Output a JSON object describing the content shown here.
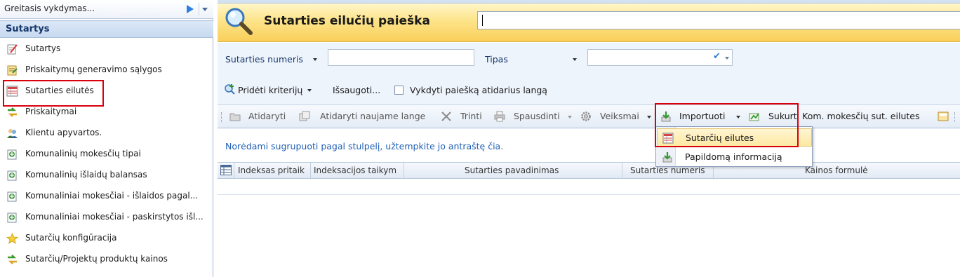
{
  "quick_launch": {
    "text": "Greitasis vykdymas..."
  },
  "nav": {
    "header": "Sutartys",
    "items": [
      {
        "label": "Sutartys",
        "icon": "edit-document-icon"
      },
      {
        "label": "Priskaitymų generavimo sąlygos",
        "icon": "conditions-icon"
      },
      {
        "label": "Sutarties eilutės",
        "icon": "table-rows-icon"
      },
      {
        "label": "Priskaitymai",
        "icon": "arrow-transfer-icon"
      },
      {
        "label": "Klientu apyvartos.",
        "icon": "people-icon"
      },
      {
        "label": "Komunalinių mokesčių tipai",
        "icon": "utility-icon"
      },
      {
        "label": "Komunalinių išlaidų balansas",
        "icon": "utility-icon"
      },
      {
        "label": "Komunaliniai mokesčiai - išlaidos pagal...",
        "icon": "utility-icon"
      },
      {
        "label": "Komunaliniai mokesčiai - paskirstytos išl...",
        "icon": "utility-icon"
      },
      {
        "label": "Sutarčių konfigūracija",
        "icon": "star-icon"
      },
      {
        "label": "Sutarčių/Projektų produktų kainos",
        "icon": "arrow-transfer-icon"
      }
    ]
  },
  "title": {
    "text": "Sutarties eilučių paieška",
    "search_value": ""
  },
  "filters": {
    "field1_label": "Sutarties numeris",
    "field2_label": "Tipas",
    "add_criteria": "Pridėti kriterijų",
    "save": "Išsaugoti...",
    "run_on_open": "Vykdyti paiešką atidarius langą"
  },
  "toolbar": {
    "open": "Atidaryti",
    "open_new": "Atidaryti naujame lange",
    "delete": "Trinti",
    "print": "Spausdinti",
    "actions": "Veiksmai",
    "import": "Importuoti",
    "create": "Sukurti Kom. mokesčių sut. eilutes"
  },
  "group_panel": "Norėdami sugrupuoti pagal stulpelį, užtempkite jo antraštę čia.",
  "grid": {
    "columns": [
      "Indeksas pritaik",
      "Indeksacijos taikym",
      "Sutarties pavadinimas",
      "Sutarties numeris",
      "Kainos formulė"
    ]
  },
  "import_menu": {
    "items": [
      "Sutarčių eilutes",
      "Papildomą informaciją"
    ]
  },
  "colors": {
    "highlight": "#d9000d",
    "accent": "#1f5fb5",
    "title_bg": "#fde48a"
  }
}
